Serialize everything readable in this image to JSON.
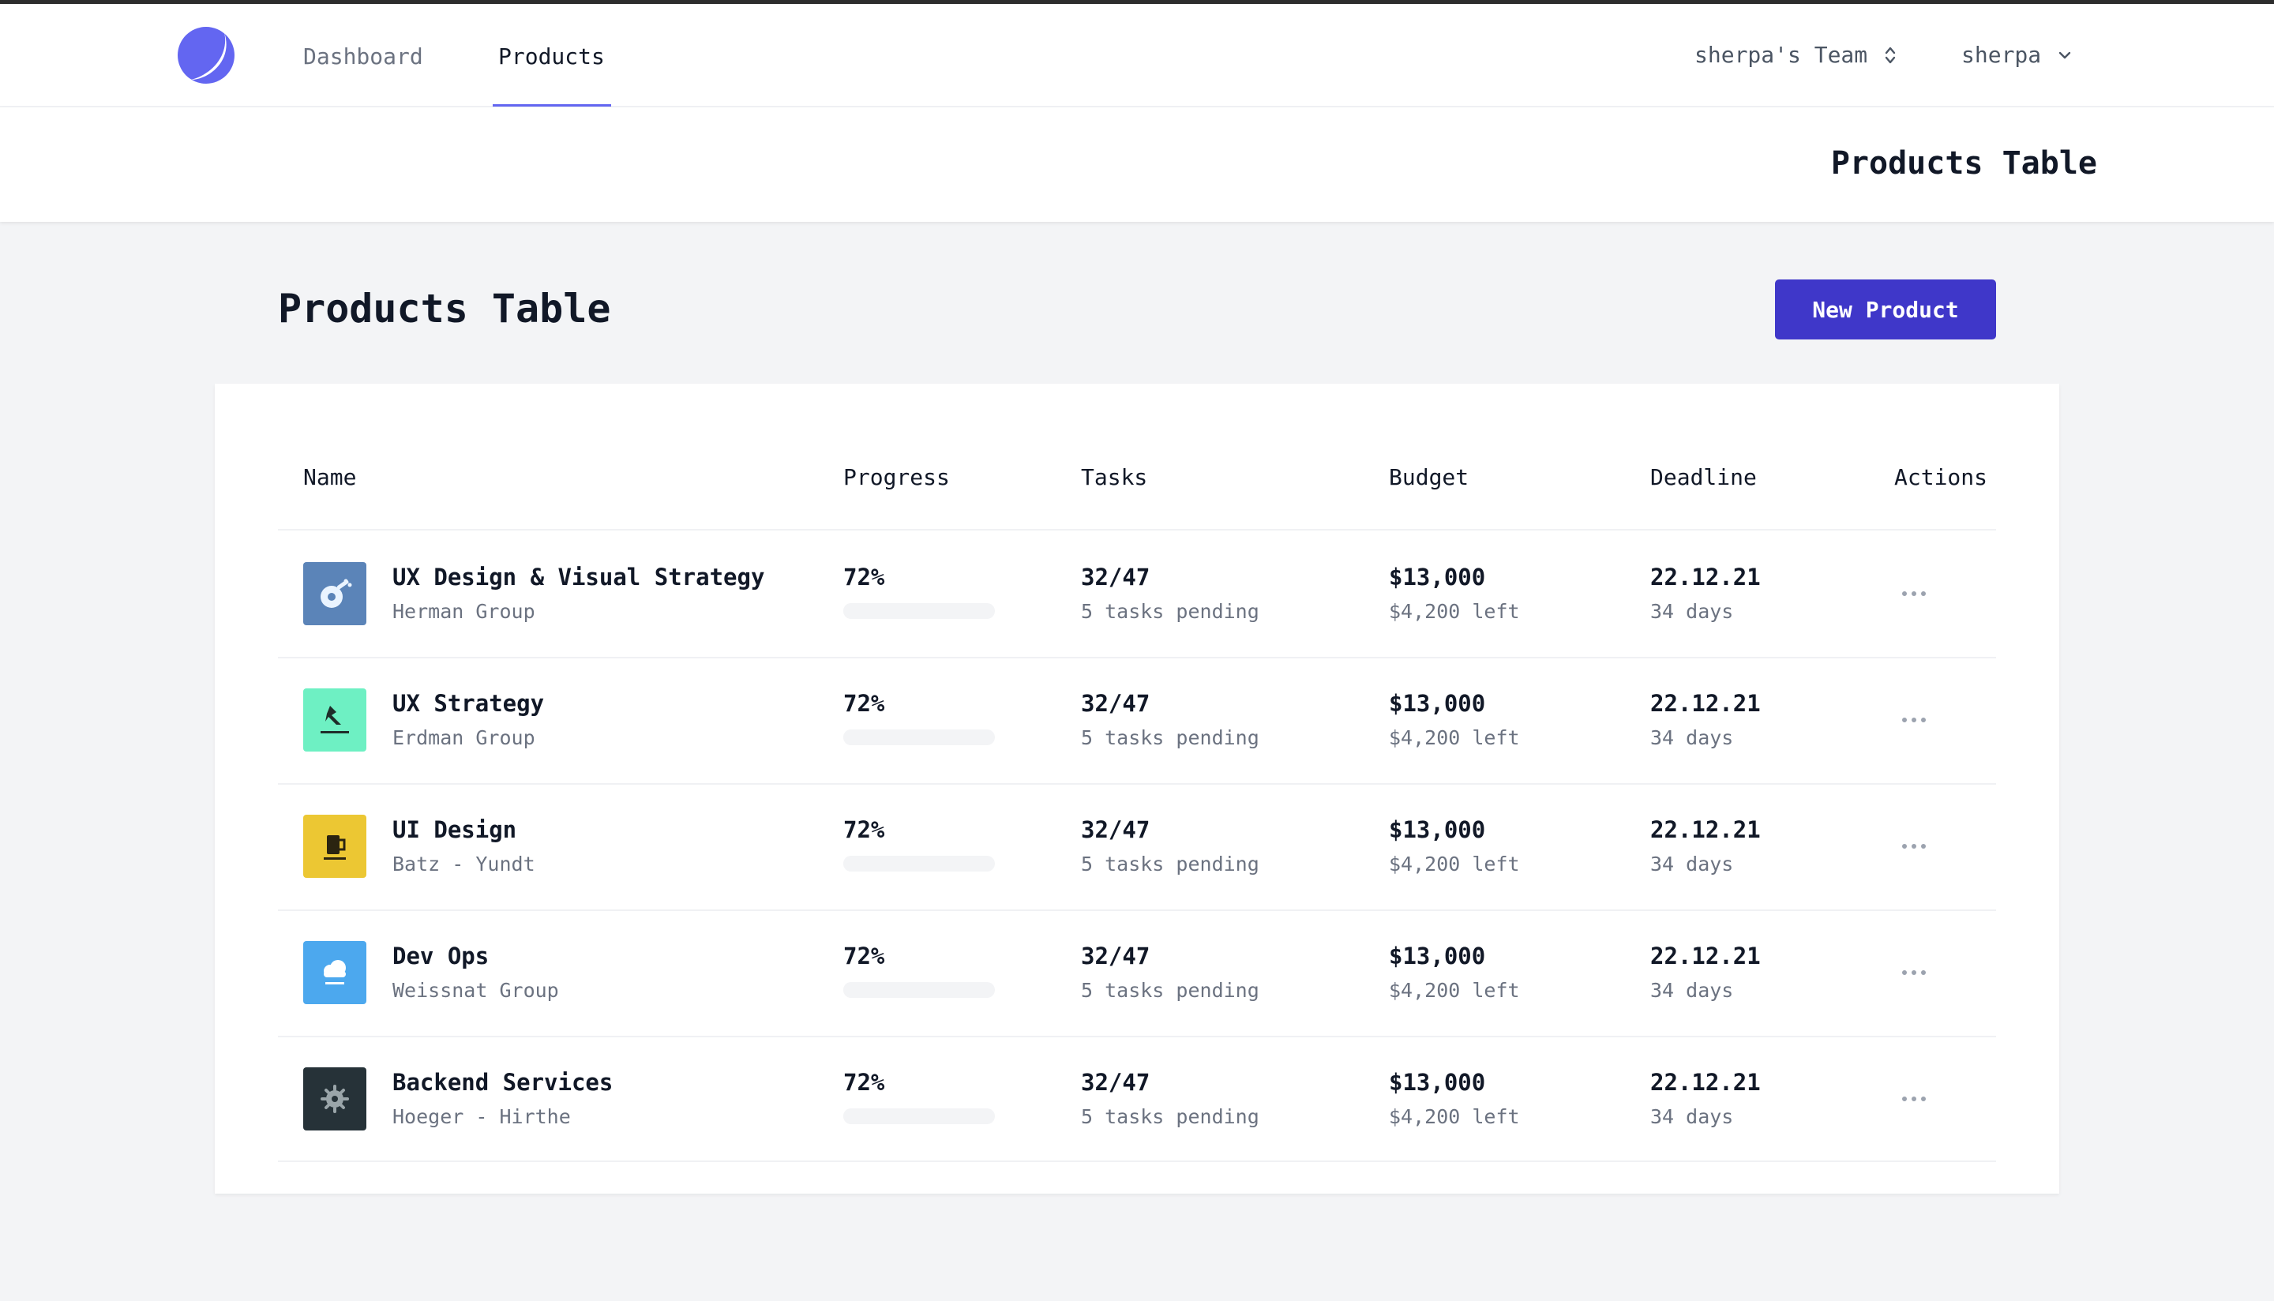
{
  "nav": {
    "links": [
      "Dashboard",
      "Products"
    ],
    "active": "Products",
    "team": "sherpa's Team",
    "user": "sherpa"
  },
  "header": {
    "title": "Products Table"
  },
  "page": {
    "title": "Products Table",
    "new_button": "New Product"
  },
  "table": {
    "columns": [
      "Name",
      "Progress",
      "Tasks",
      "Budget",
      "Deadline",
      "Actions"
    ],
    "rows": [
      {
        "name": "UX Design & Visual Strategy",
        "company": "Herman Group",
        "progress": "72%",
        "progress_value": 0.72,
        "tasks": "32/47",
        "tasks_pending": "5 tasks pending",
        "budget": "$13,000",
        "budget_left": "$4,200 left",
        "deadline": "22.12.21",
        "days": "34 days",
        "thumb_color": "#5b84b8",
        "icon": "guitar-logo-icon"
      },
      {
        "name": "UX Strategy",
        "company": "Erdman Group",
        "progress": "72%",
        "progress_value": 0.72,
        "tasks": "32/47",
        "tasks_pending": "5 tasks pending",
        "budget": "$13,000",
        "budget_left": "$4,200 left",
        "deadline": "22.12.21",
        "days": "34 days",
        "thumb_color": "#6ef0c3",
        "icon": "bird-logo-icon"
      },
      {
        "name": "UI Design",
        "company": "Batz - Yundt",
        "progress": "72%",
        "progress_value": 0.72,
        "tasks": "32/47",
        "tasks_pending": "5 tasks pending",
        "budget": "$13,000",
        "budget_left": "$4,200 left",
        "deadline": "22.12.21",
        "days": "34 days",
        "thumb_color": "#ecc733",
        "icon": "beer-mug-logo-icon"
      },
      {
        "name": "Dev Ops",
        "company": "Weissnat Group",
        "progress": "72%",
        "progress_value": 0.72,
        "tasks": "32/47",
        "tasks_pending": "5 tasks pending",
        "budget": "$13,000",
        "budget_left": "$4,200 left",
        "deadline": "22.12.21",
        "days": "34 days",
        "thumb_color": "#4ca8ee",
        "icon": "cloud-logo-icon"
      },
      {
        "name": "Backend Services",
        "company": "Hoeger - Hirthe",
        "progress": "72%",
        "progress_value": 0.72,
        "tasks": "32/47",
        "tasks_pending": "5 tasks pending",
        "budget": "$13,000",
        "budget_left": "$4,200 left",
        "deadline": "22.12.21",
        "days": "34 days",
        "thumb_color": "#263238",
        "icon": "gear-logo-icon"
      }
    ]
  },
  "colors": {
    "accent": "#6366f1",
    "button": "#3f37c9",
    "background": "#f3f4f6"
  }
}
